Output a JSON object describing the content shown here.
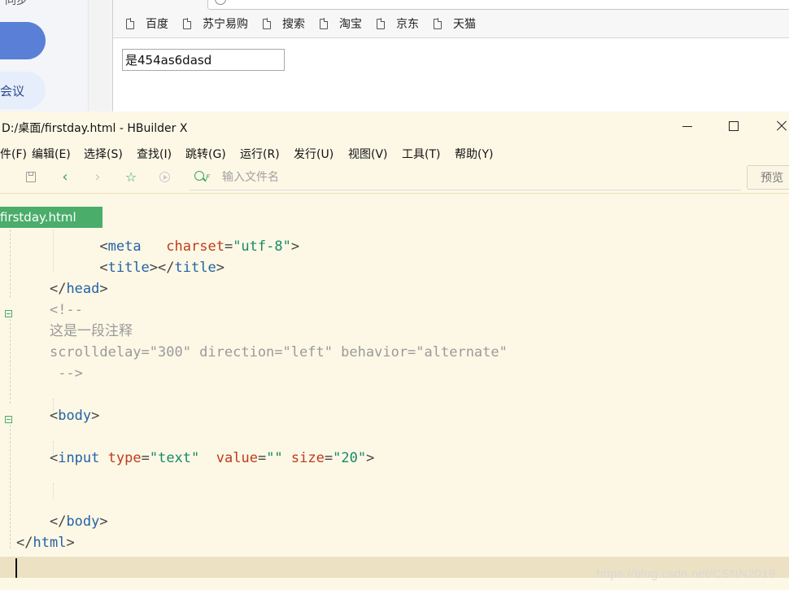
{
  "left_app": {
    "top_text": "同步",
    "meeting_label": "会议"
  },
  "browser": {
    "bookmarks": [
      "百度",
      "苏宁易购",
      "搜索",
      "淘宝",
      "京东",
      "天猫"
    ],
    "page_input_value": "是454as6dasd"
  },
  "editor": {
    "window_title": "D:/桌面/firstday.html - HBuilder X",
    "menu": [
      "件(F)",
      "编辑(E)",
      "选择(S)",
      "查找(I)",
      "跳转(G)",
      "运行(R)",
      "发行(U)",
      "视图(V)",
      "工具(T)",
      "帮助(Y)"
    ],
    "search_placeholder": "输入文件名",
    "search_icon_letter": "F",
    "preview_label": "预览",
    "active_tab": "firstday.html",
    "code_lines": {
      "l1_tag": "meta",
      "l1_attr": "charset",
      "l1_val": "\"utf-8\"",
      "l2_open": "title",
      "l2_close": "title",
      "l3_tag": "head",
      "l4": "<!--",
      "l5": "这是一段注释",
      "l6": "scrolldelay=\"300\" direction=\"left\" behavior=\"alternate\"",
      "l7": " -->",
      "l9_tag": "body",
      "l11_tag": "input",
      "l11_a1": "type",
      "l11_v1": "\"text\"",
      "l11_a2": "value",
      "l11_v2": "\"\"",
      "l11_a3": "size",
      "l11_v3": "\"20\"",
      "l14_tag": "body",
      "l15_tag": "html"
    }
  },
  "watermark": "https://blog.csdn.net/CSNN2019"
}
